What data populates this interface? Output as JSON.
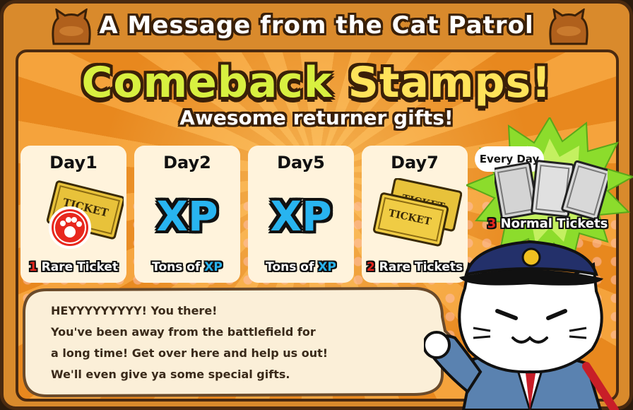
{
  "header": {
    "title": "A Message from the Cat Patrol"
  },
  "banner": {
    "title_part1": "Comeback",
    "title_part2": "Stamps!",
    "subtitle": "Awesome returner gifts!"
  },
  "stamps": [
    {
      "day": "Day1",
      "reward_count": "1",
      "reward_text": "Rare Ticket",
      "icon": "rare-ticket-icon"
    },
    {
      "day": "Day2",
      "reward_prefix": "Tons of",
      "reward_xp": "XP",
      "art_text": "XP",
      "icon": "xp-icon"
    },
    {
      "day": "Day5",
      "reward_prefix": "Tons of",
      "reward_xp": "XP",
      "art_text": "XP",
      "icon": "xp-icon"
    },
    {
      "day": "Day7",
      "reward_count": "2",
      "reward_text": "Rare Tickets",
      "icon": "rare-tickets-icon"
    }
  ],
  "every_day": {
    "label": "Every Day",
    "reward_count": "3",
    "reward_text": "Normal Tickets",
    "icon": "normal-tickets-icon"
  },
  "ticket_art_text": "TICKET",
  "message": {
    "lines": [
      "HEYYYYYYYYY! You there!",
      "You've been away from the battlefield for",
      "a long time! Get over here and help us out!",
      "We'll even give ya some special gifts."
    ]
  },
  "colors": {
    "title_green": "#d8f040",
    "xp_blue": "#28b4f0",
    "count_red": "#e8281e",
    "burst_green": "#8cdc2c",
    "frame_orange": "#f5a33c"
  }
}
